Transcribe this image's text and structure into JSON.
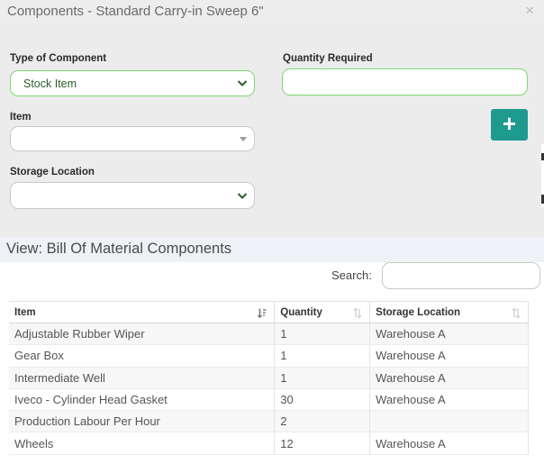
{
  "dialog": {
    "title": "Components - Standard Carry-in Sweep 6\"",
    "close": "×"
  },
  "form": {
    "type_label": "Type of Component",
    "type_value": "Stock Item",
    "quantity_label": "Quantity Required",
    "quantity_value": "",
    "item_label": "Item",
    "item_value": "",
    "storage_label": "Storage Location",
    "storage_value": "",
    "add_label": "+"
  },
  "section": {
    "title": "View: Bill Of Material Components"
  },
  "search": {
    "label": "Search:",
    "value": ""
  },
  "table": {
    "headers": [
      "Item",
      "Quantity",
      "Storage Location"
    ],
    "rows": [
      [
        "Adjustable Rubber Wiper",
        "1",
        "Warehouse A"
      ],
      [
        "Gear Box",
        "1",
        "Warehouse A"
      ],
      [
        "Intermediate Well",
        "1",
        "Warehouse A"
      ],
      [
        "Iveco - Cylinder Head Gasket",
        "30",
        "Warehouse A"
      ],
      [
        "Production Labour Per Hour",
        "2",
        ""
      ],
      [
        "Wheels",
        "12",
        "Warehouse A"
      ]
    ]
  },
  "colors": {
    "accent_green": "#7ed672",
    "add_button": "#1f9a8f",
    "title_bar": "#ededed",
    "section_bar": "#eef2f7"
  },
  "icons": {
    "close": "close-icon",
    "add": "plus-icon",
    "sort_active": "sort-asc-icon",
    "sort": "sort-icon"
  }
}
